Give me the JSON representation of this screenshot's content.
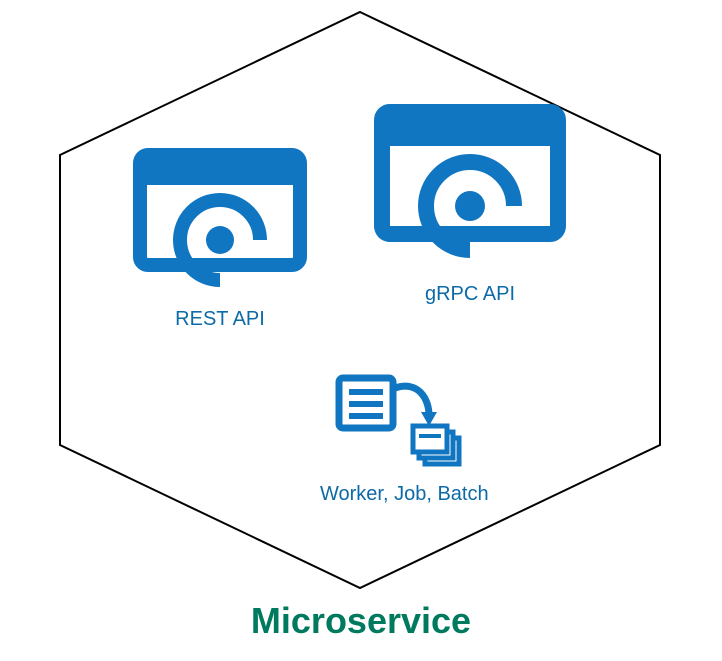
{
  "diagram": {
    "title": "Microservice",
    "colors": {
      "hex_stroke": "#000000",
      "icon_primary": "#1176c2",
      "label_color": "#0d6aa8",
      "title_color": "#007a5e"
    },
    "nodes": {
      "rest_api": {
        "label": "REST API"
      },
      "grpc_api": {
        "label": "gRPC API"
      },
      "worker": {
        "label": "Worker, Job, Batch"
      }
    }
  }
}
